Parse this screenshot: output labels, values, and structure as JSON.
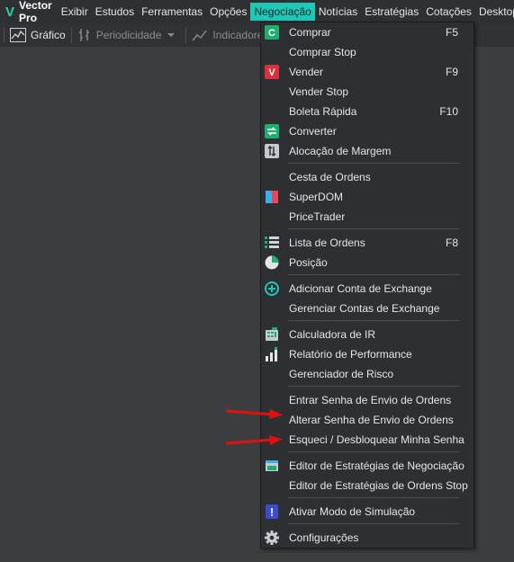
{
  "app": {
    "logo_letter": "V",
    "name": "Vector Pro"
  },
  "menubar": {
    "items": [
      "Exibir",
      "Estudos",
      "Ferramentas",
      "Opções",
      "Negociação",
      "Notícias",
      "Estratégias",
      "Cotações",
      "Desktop"
    ],
    "active": "Negociação"
  },
  "toolbar": {
    "chart_label": "Gráfico",
    "periodicity_label": "Periodicidade",
    "indicators_label": "Indicadores"
  },
  "menu": {
    "comprar": {
      "label": "Comprar",
      "shortcut": "F5",
      "icon": "C"
    },
    "comprar_stop": {
      "label": "Comprar Stop"
    },
    "vender": {
      "label": "Vender",
      "shortcut": "F9",
      "icon": "V"
    },
    "vender_stop": {
      "label": "Vender Stop"
    },
    "boleta_rapida": {
      "label": "Boleta Rápida",
      "shortcut": "F10"
    },
    "converter": {
      "label": "Converter"
    },
    "alocacao_margem": {
      "label": "Alocação de Margem"
    },
    "cesta_ordens": {
      "label": "Cesta de Ordens"
    },
    "superdom": {
      "label": "SuperDOM"
    },
    "pricetrader": {
      "label": "PriceTrader"
    },
    "lista_ordens": {
      "label": "Lista de Ordens",
      "shortcut": "F8"
    },
    "posicao": {
      "label": "Posição"
    },
    "adicionar_conta": {
      "label": "Adicionar Conta de Exchange"
    },
    "gerenciar_contas": {
      "label": "Gerenciar Contas de Exchange"
    },
    "calculadora_ir": {
      "label": "Calculadora de IR"
    },
    "relatorio_performance": {
      "label": "Relatório de Performance"
    },
    "gerenciador_risco": {
      "label": "Gerenciador de Risco"
    },
    "entrar_senha": {
      "label": "Entrar Senha de Envio de Ordens"
    },
    "alterar_senha": {
      "label": "Alterar Senha de Envio de Ordens"
    },
    "esqueci_senha": {
      "label": "Esqueci / Desbloquear Minha Senha"
    },
    "editor_estrategias_neg": {
      "label": "Editor de Estratégias de Negociação"
    },
    "editor_estrategias_stop": {
      "label": "Editor de Estratégias de Ordens Stop"
    },
    "ativar_simulacao": {
      "label": "Ativar Modo de Simulação",
      "icon": "!"
    },
    "configuracoes": {
      "label": "Configurações"
    }
  },
  "colors": {
    "accent": "#1fc7b7",
    "buy": "#1fae6f",
    "sell": "#d9323f",
    "annotation_arrow": "#e01010"
  },
  "icons": {
    "chart": "line-chart-icon",
    "periodicity": "bar-period-icon",
    "indicators": "indicator-icon"
  }
}
